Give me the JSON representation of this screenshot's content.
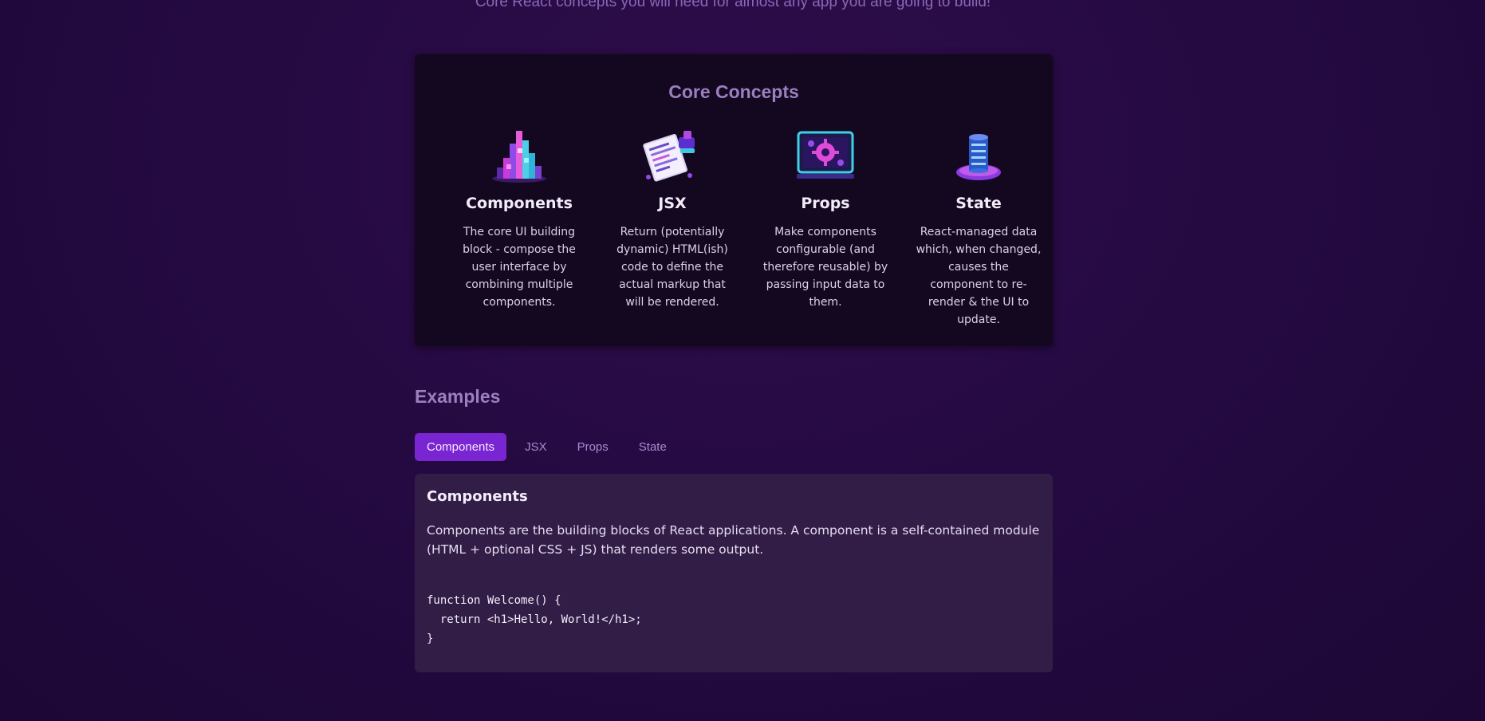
{
  "header": {
    "subtitle": "Core React concepts you will need for almost any app you are going to build!"
  },
  "core_concepts": {
    "title": "Core Concepts",
    "items": [
      {
        "icon": "components-illustration",
        "title": "Components",
        "description": "The core UI building block - compose the user interface by combining multiple components."
      },
      {
        "icon": "jsx-illustration",
        "title": "JSX",
        "description": "Return (potentially dynamic) HTML(ish) code to define the actual markup that will be rendered."
      },
      {
        "icon": "props-illustration",
        "title": "Props",
        "description": "Make components configurable (and therefore reusable) by passing input data to them."
      },
      {
        "icon": "state-illustration",
        "title": "State",
        "description": "React-managed data which, when changed, causes the component to re-render & the UI to update."
      }
    ]
  },
  "examples": {
    "title": "Examples",
    "tabs": [
      "Components",
      "JSX",
      "Props",
      "State"
    ],
    "selected_tab": "Components",
    "content": {
      "title": "Components",
      "description": "Components are the building blocks of React applications. A component is a self-contained module (HTML + optional CSS + JS) that renders some output.",
      "code": "function Welcome() {\n  return <h1>Hello, World!</h1>;\n}"
    }
  },
  "colors": {
    "accent": "#7a25d2",
    "background": "#250a42",
    "card": "#140720",
    "content_panel": "#321d46"
  }
}
